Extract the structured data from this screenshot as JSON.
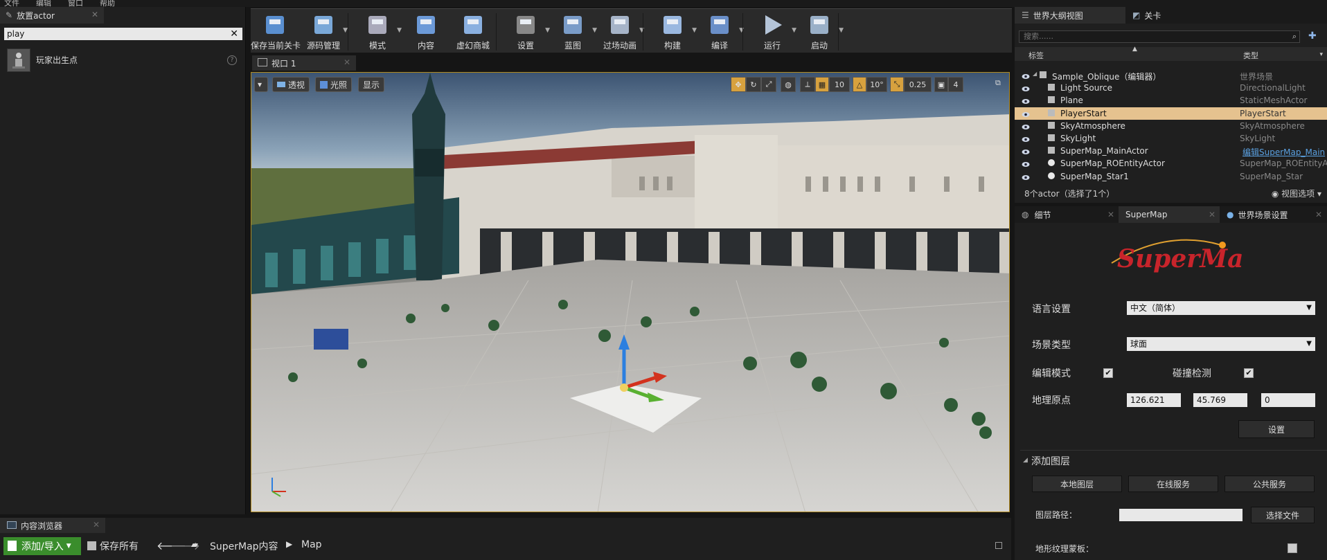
{
  "menubar": {
    "items": [
      "文件",
      "编辑",
      "窗口",
      "帮助"
    ]
  },
  "place_actor": {
    "tab": "放置actor",
    "search_value": "play",
    "result_label": "玩家出生点"
  },
  "toolbar": {
    "buttons": [
      {
        "label": "保存当前关卡",
        "icon": "save-icon"
      },
      {
        "label": "源码管理",
        "icon": "source-control-icon"
      },
      {
        "label": "模式",
        "icon": "modes-icon"
      },
      {
        "label": "内容",
        "icon": "content-icon"
      },
      {
        "label": "虚幻商城",
        "icon": "marketplace-icon"
      },
      {
        "label": "设置",
        "icon": "settings-icon"
      },
      {
        "label": "蓝图",
        "icon": "blueprint-icon"
      },
      {
        "label": "过场动画",
        "icon": "cinematics-icon"
      },
      {
        "label": "构建",
        "icon": "build-icon"
      },
      {
        "label": "编译",
        "icon": "compile-icon"
      },
      {
        "label": "运行",
        "icon": "play-icon"
      },
      {
        "label": "启动",
        "icon": "launch-icon"
      }
    ]
  },
  "viewport": {
    "tab": "视口 1",
    "perspective": "透视",
    "lit": "光照",
    "show": "显示",
    "grid_snap": "10",
    "rot_snap": "10°",
    "scale_snap": "0.25",
    "cam_speed": "4"
  },
  "outliner": {
    "tab": "世界大纲视图",
    "tab2": "关卡",
    "search_placeholder": "搜索......",
    "col_label": "标签",
    "col_type": "类型",
    "rows": [
      {
        "name": "Sample_Oblique（编辑器）",
        "type": "世界场景",
        "indent": 0,
        "icon": "world-icon",
        "selected": false
      },
      {
        "name": "Light Source",
        "type": "DirectionalLight",
        "indent": 1,
        "icon": "directional-light-icon",
        "selected": false
      },
      {
        "name": "Plane",
        "type": "StaticMeshActor",
        "indent": 1,
        "icon": "static-mesh-icon",
        "selected": false
      },
      {
        "name": "PlayerStart",
        "type": "PlayerStart",
        "indent": 1,
        "icon": "player-start-icon",
        "selected": true
      },
      {
        "name": "SkyAtmosphere",
        "type": "SkyAtmosphere",
        "indent": 1,
        "icon": "sky-atmosphere-icon",
        "selected": false
      },
      {
        "name": "SkyLight",
        "type": "SkyLight",
        "indent": 1,
        "icon": "sky-light-icon",
        "selected": false
      },
      {
        "name": "SuperMap_MainActor",
        "type": "编辑SuperMap_Main",
        "indent": 1,
        "icon": "actor-icon",
        "selected": false,
        "link": true
      },
      {
        "name": "SuperMap_ROEntityActor",
        "type": "SuperMap_ROEntityAc",
        "indent": 1,
        "icon": "sphere-icon",
        "selected": false
      },
      {
        "name": "SuperMap_Star1",
        "type": "SuperMap_Star",
        "indent": 1,
        "icon": "sphere-icon",
        "selected": false
      }
    ],
    "footer": "8个actor（选择了1个）",
    "view_options": "视图选项"
  },
  "details": {
    "tabs": [
      "细节",
      "SuperMap",
      "世界场景设置"
    ],
    "logo": "SuperMap",
    "lang_label": "语言设置",
    "lang_value": "中文（简体）",
    "scene_label": "场景类型",
    "scene_value": "球面",
    "edit_label": "编辑模式",
    "collision_label": "碰撞检测",
    "geo_label": "地理原点",
    "geo_x": "126.621",
    "geo_y": "45.769",
    "geo_z": "0",
    "setup_btn": "设置",
    "add_layer": "添加图层",
    "local_layer": "本地图层",
    "online_service": "在线服务",
    "public_service": "公共服务",
    "layer_path_label": "图层路径：",
    "select_file": "选择文件",
    "terrain_mask_label": "地形纹理蒙板："
  },
  "content_browser": {
    "tab": "内容浏览器",
    "add_import": "添加/导入",
    "save_all": "保存所有",
    "path_root": "SuperMap内容",
    "path_leaf": "Map"
  },
  "colors": {
    "accent": "#b08a20",
    "selected_row": "#e5c28f",
    "add_button": "#3a8d2c",
    "link": "#5aa0e0"
  }
}
